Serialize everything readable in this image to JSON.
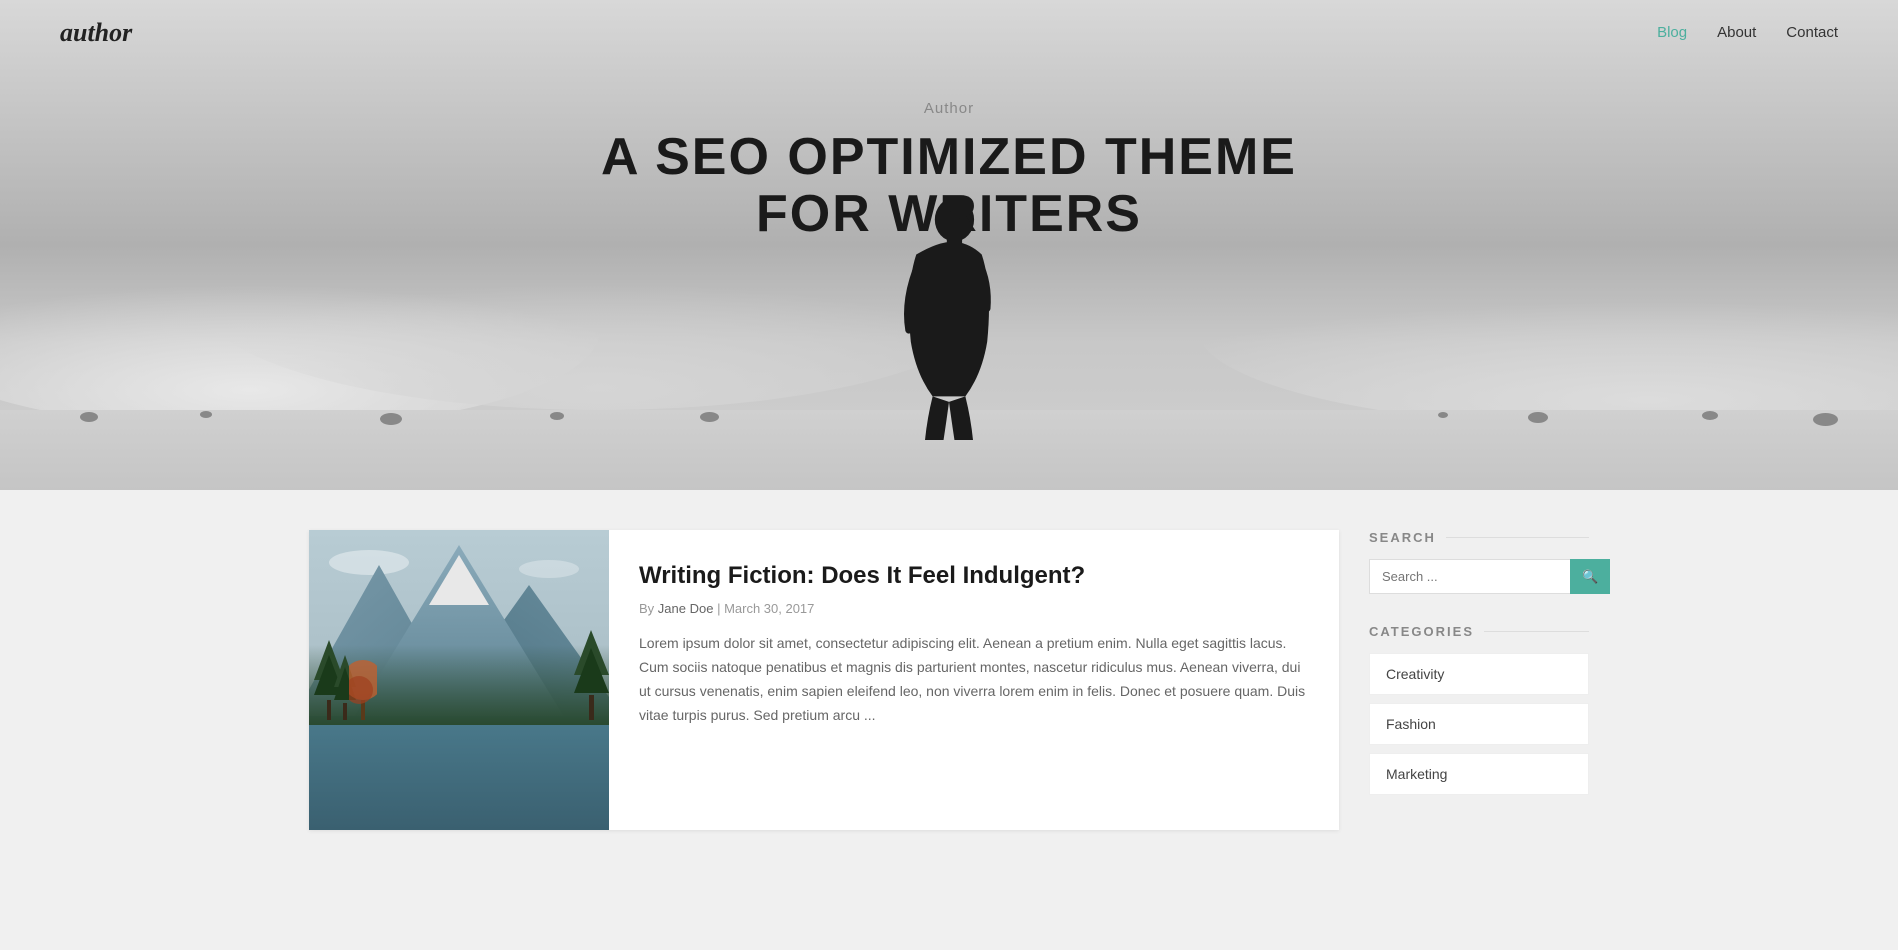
{
  "header": {
    "logo": "author",
    "nav": [
      {
        "label": "Blog",
        "href": "#",
        "active": true
      },
      {
        "label": "About",
        "href": "#",
        "active": false
      },
      {
        "label": "Contact",
        "href": "#",
        "active": false
      }
    ]
  },
  "hero": {
    "subtitle": "Author",
    "title_line1": "A SEO OPTIMIZED THEME",
    "title_line2": "FOR WRITERS"
  },
  "posts": [
    {
      "title": "Writing Fiction: Does It Feel Indulgent?",
      "author": "Jane Doe",
      "date": "March 30, 2017",
      "excerpt": "Lorem ipsum dolor sit amet, consectetur adipiscing elit. Aenean a pretium enim. Nulla eget sagittis lacus. Cum sociis natoque penatibus et magnis dis parturient montes, nascetur ridiculus mus. Aenean viverra, dui ut cursus venenatis, enim sapien eleifend leo, non viverra lorem enim in felis. Donec et posuere quam. Duis vitae turpis purus. Sed pretium arcu ..."
    }
  ],
  "sidebar": {
    "search_heading": "SEARCH",
    "search_placeholder": "Search ...",
    "categories_heading": "CATEGORIES",
    "categories": [
      {
        "label": "Creativity"
      },
      {
        "label": "Fashion"
      },
      {
        "label": "Marketing"
      }
    ]
  }
}
